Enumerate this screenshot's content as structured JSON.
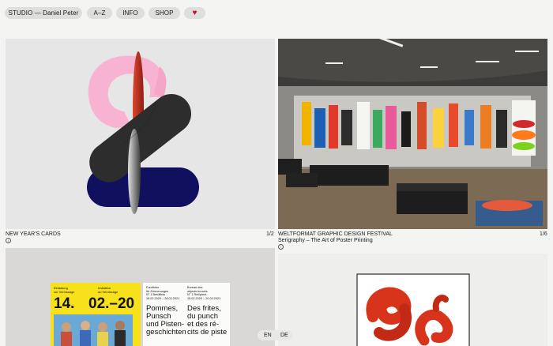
{
  "nav": {
    "studio": "STUDIO — Daniel Peter",
    "az": "A–Z",
    "info": "INFO",
    "shop": "SHOP",
    "heart_icon": "heart-icon",
    "heart_color": "#c8102e"
  },
  "projects": [
    {
      "title": "NEW YEAR'S CARDS",
      "subtitle": "",
      "counter": "1/2",
      "info_icon": "info-icon"
    },
    {
      "title": "WELTFORMAT GRAPHIC DESIGN FESTIVAL",
      "subtitle": "Serigraphy – The Art of Poster Printing",
      "counter": "1/6",
      "info_icon": "info-icon"
    }
  ],
  "poster": {
    "small1": "Einladung\nzur Vernissage",
    "small2": "Invitation\nau Vernissage",
    "day": "14.",
    "date": "02.–20",
    "col1_head": "Fundbüro\nfür Erinnerungen\nN° 1 Behältnis\n15.02.2020 – 28.02.2021",
    "col2_head": "Bureau des\nobjects trouvés\nN° 1 Récipient\n15.02.2020 – 20.02.2021",
    "col1_big": "Pommes,\nPunsch\nund Pisten-\ngeschichten",
    "col2_big": "Des frites,\ndu punch\net des ré-\ncits de piste"
  },
  "language": {
    "en": "EN",
    "de": "DE"
  },
  "colors": {
    "accent": "#c8102e",
    "pill_bg": "#dededc",
    "background": "#f4f4f3"
  }
}
